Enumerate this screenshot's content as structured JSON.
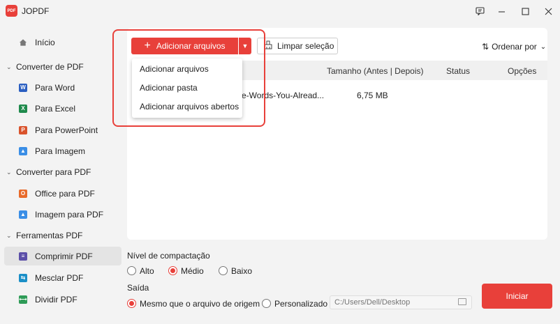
{
  "app": {
    "title": "JOPDF",
    "logo_text": "PDF"
  },
  "sidebar": {
    "home": "Início",
    "sections": [
      {
        "title": "Converter de PDF",
        "items": [
          "Para Word",
          "Para Excel",
          "Para PowerPoint",
          "Para Imagem"
        ]
      },
      {
        "title": "Converter para PDF",
        "items": [
          "Office para PDF",
          "Imagem para PDF"
        ]
      },
      {
        "title": "Ferramentas PDF",
        "items": [
          "Comprimir PDF",
          "Mesclar PDF",
          "Dividir PDF"
        ]
      }
    ],
    "active_item": "Comprimir PDF"
  },
  "toolbar": {
    "add_files": "Adicionar arquivos",
    "clear_selection": "Limpar seleção",
    "sort_by": "Ordenar por"
  },
  "dropdown": {
    "items": [
      "Adicionar arquivos",
      "Adicionar pasta",
      "Adicionar arquivos abertos"
    ]
  },
  "table": {
    "columns": [
      "Tamanho (Antes | Depois)",
      "Status",
      "Opções"
    ],
    "rows": [
      {
        "name": "e-Words-You-Alread...",
        "size": "6,75 MB"
      }
    ]
  },
  "compression": {
    "label": "Nível de compactação",
    "options": [
      "Alto",
      "Médio",
      "Baixo"
    ],
    "selected": "Médio"
  },
  "output": {
    "label": "Saída",
    "options": [
      "Mesmo que o arquivo de origem",
      "Personalizado"
    ],
    "selected": "Mesmo que o arquivo de origem",
    "path_placeholder": "C:/Users/Dell/Desktop"
  },
  "start_button": "Iniciar",
  "colors": {
    "accent": "#e8403a",
    "word": "#2b5fc1",
    "excel": "#1f8a4c",
    "powerpoint": "#d9532c",
    "image": "#3a8ee6",
    "office": "#e86a2a"
  }
}
